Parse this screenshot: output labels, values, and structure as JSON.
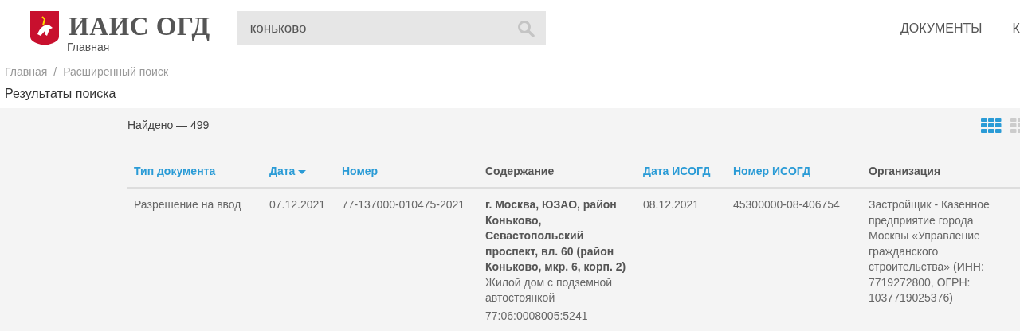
{
  "header": {
    "title": "ИАИС ОГД",
    "subtitle": "Главная",
    "search": {
      "value": "коньково"
    },
    "nav": [
      "ДОКУМЕНТЫ",
      "К"
    ]
  },
  "breadcrumbs": [
    "Главная",
    "Расширенный поиск"
  ],
  "breadcrumb_separator": "/",
  "page_title": "Результаты поиска",
  "results": {
    "count": "Найдено — 499",
    "views": [
      {
        "kind": "grid",
        "selected": true
      },
      {
        "kind": "list",
        "selected": false
      }
    ],
    "columns": [
      {
        "label": "Тип документа",
        "sortable": true,
        "sorted": false
      },
      {
        "label": "Дата",
        "sortable": true,
        "sorted": true
      },
      {
        "label": "Номер",
        "sortable": true,
        "sorted": false
      },
      {
        "label": "Содержание",
        "sortable": false,
        "sorted": false
      },
      {
        "label": "Дата ИСОГД",
        "sortable": true,
        "sorted": false
      },
      {
        "label": "Номер ИСОГД",
        "sortable": true,
        "sorted": false
      },
      {
        "label": "Организация",
        "sortable": false,
        "sorted": false
      }
    ],
    "rows": [
      {
        "type": "Разрешение на ввод",
        "date": "07.12.2021",
        "number": "77-137000-010475-2021",
        "address": "г. Москва, ЮЗАО, район Коньково, Севастопольский проспект, вл. 60 (район Коньково, мкр. 6, корп. 2)",
        "description": "Жилой дом с подземной автостоянкой",
        "cadastral": "77:06:0008005:5241",
        "isogd_date": "08.12.2021",
        "isogd_number": "45300000-08-406754",
        "organization": "Застройщик - Казенное предприятие города Москвы «Управление гражданского строительства» (ИНН: 7719272800, ОГРН: 1037719025376)"
      }
    ]
  }
}
